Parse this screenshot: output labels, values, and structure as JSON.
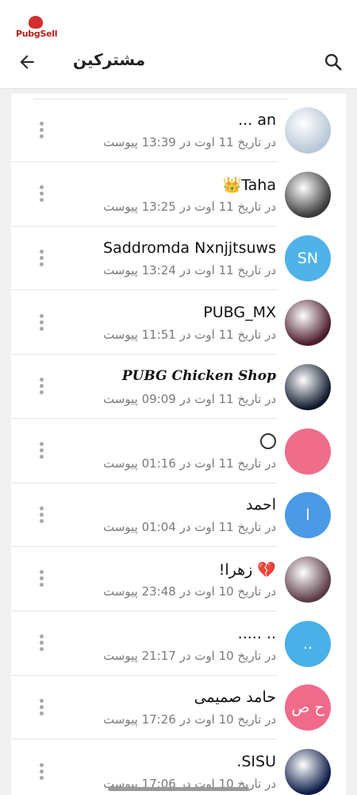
{
  "app": {
    "brand": "PubgSell",
    "title": "مشترکین"
  },
  "icons": {
    "back": "arrow-left-icon",
    "search": "search-icon",
    "menu": "more-vert-icon"
  },
  "subscribers": [
    {
      "name": "an ...",
      "subtitle": "در تاریخ 11 اوت در 13:39 پیوست",
      "avatar_text": "",
      "avatar_color": "#b7c7d6",
      "avatar_kind": "image",
      "fancy": false
    },
    {
      "name": "Taha👑",
      "subtitle": "در تاریخ 11 اوت در 13:25 پیوست",
      "avatar_text": "",
      "avatar_color": "#3a3a3a",
      "avatar_kind": "image",
      "fancy": false
    },
    {
      "name": "Saddromda Nxnjjtsuws",
      "subtitle": "در تاریخ 11 اوت در 13:24 پیوست",
      "avatar_text": "SN",
      "avatar_color": "#4fb2e8",
      "avatar_kind": "initials",
      "fancy": false
    },
    {
      "name": "PUBG_MX",
      "subtitle": "در تاریخ 11 اوت در 11:51 پیوست",
      "avatar_text": "",
      "avatar_color": "#4a1c2a",
      "avatar_kind": "image",
      "fancy": false
    },
    {
      "name": "PUBG Chicken Shop",
      "subtitle": "در تاریخ 11 اوت در 09:09 پیوست",
      "avatar_text": "",
      "avatar_color": "#101a2e",
      "avatar_kind": "image",
      "fancy": true
    },
    {
      "name": "",
      "subtitle": "در تاریخ 11 اوت در 01:16 پیوست",
      "avatar_text": "",
      "avatar_color": "#ef6d8a",
      "avatar_kind": "initials",
      "fancy": false,
      "ring": true
    },
    {
      "name": "احمد",
      "subtitle": "در تاریخ 11 اوت در 01:04 پیوست",
      "avatar_text": "ا",
      "avatar_color": "#4a9ae6",
      "avatar_kind": "initials",
      "fancy": false
    },
    {
      "name": "💔 زهرا!",
      "subtitle": "در تاریخ 10 اوت در 23:48 پیوست",
      "avatar_text": "",
      "avatar_color": "#5a3a45",
      "avatar_kind": "image",
      "fancy": false
    },
    {
      "name": ".. .....",
      "subtitle": "در تاریخ 10 اوت در 21:17 پیوست",
      "avatar_text": "..",
      "avatar_color": "#4ab0e8",
      "avatar_kind": "initials",
      "fancy": false
    },
    {
      "name": "حامد صمیمی",
      "subtitle": "در تاریخ 10 اوت در 17:26 پیوست",
      "avatar_text": "ح ص",
      "avatar_color": "#f06a8a",
      "avatar_kind": "initials",
      "fancy": false
    },
    {
      "name": "SISU.",
      "subtitle": "در تاریخ 10 اوت در 17:06 پیوست",
      "avatar_text": "",
      "avatar_color": "#0c1c48",
      "avatar_kind": "image",
      "fancy": false
    }
  ]
}
